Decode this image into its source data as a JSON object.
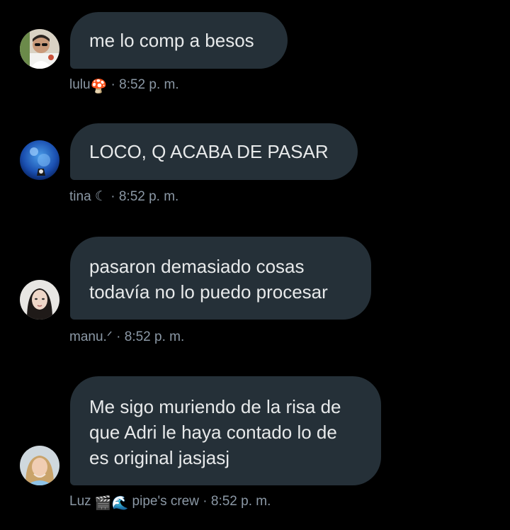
{
  "messages": [
    {
      "lines": [
        "me lo comp a besos"
      ],
      "sender": "lulu",
      "sender_emoji": "🍄",
      "separator": "·",
      "time": "8:52 p. m.",
      "avatar": "user-avatar-lulu"
    },
    {
      "lines": [
        "LOCO, Q ACABA DE PASAR"
      ],
      "sender": "tina ☾",
      "separator": "·",
      "time": "8:52 p. m.",
      "avatar": "user-avatar-tina"
    },
    {
      "lines": [
        "pasaron demasiado cosas",
        "todavía no lo puedo procesar"
      ],
      "sender": "manu.ᐟ",
      "separator": "·",
      "time": "8:52 p. m.",
      "avatar": "user-avatar-manu"
    },
    {
      "lines": [
        "Me sigo muriendo de la risa de",
        "que Adri le haya contado lo de",
        "es original jasjasj"
      ],
      "sender": "Luz",
      "sender_emoji": "🎬🌊",
      "sender_suffix": "pipe's crew",
      "separator": "·",
      "time": "8:52 p. m.",
      "avatar": "user-avatar-luz"
    }
  ],
  "colors": {
    "background": "#000000",
    "bubble": "#253038",
    "text": "#e7e9ea",
    "meta": "#8b98a5"
  }
}
